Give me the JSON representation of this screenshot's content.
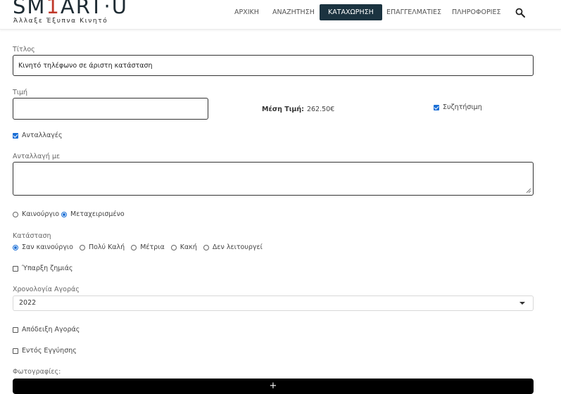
{
  "header": {
    "logo_pre": "SM",
    "logo_accent": "1",
    "logo_post": "ART·U",
    "tagline": "Άλλαξε Έξυπνα Κινητό",
    "nav": [
      {
        "label": "ΑΡΧΙΚΗ",
        "active": false
      },
      {
        "label": "ΑΝΑΖΗΤΗΣΗ",
        "active": false
      },
      {
        "label": "ΚΑΤΑΧΩΡΗΣΗ",
        "active": true
      },
      {
        "label": "ΕΠΑΓΓΕΛΜΑΤΙΕΣ",
        "active": false
      },
      {
        "label": "ΠΛΗΡΟΦΟΡΙΕΣ",
        "active": false
      }
    ],
    "search_icon": "search-icon",
    "active_color": "#1b3340"
  },
  "form": {
    "title_label": "Τίτλος",
    "title_value": "Κινητό τηλέφωνο σε άριστη κατάσταση",
    "price_label": "Τιμή",
    "price_value": "",
    "avg_price_label": "Μέση Τιμή:",
    "avg_price_value": "262.50€",
    "negotiable_label": "Συζητήσιμη",
    "negotiable_checked": true,
    "exchanges_label": "Ανταλλαγές",
    "exchanges_checked": true,
    "exchange_with_label": "Ανταλλαγή με",
    "exchange_with_value": "",
    "newness": {
      "options": [
        "Καινούργιο",
        "Μεταχειρισμένο"
      ],
      "selected": 1
    },
    "condition_label": "Κατάσταση",
    "condition": {
      "options": [
        "Σαν καινούργιο",
        "Πολύ Καλή",
        "Μέτρια",
        "Κακή",
        "Δεν λειτουργεί"
      ],
      "selected": 0
    },
    "damage_label": "Ύπαρξη ζημιάς",
    "damage_checked": false,
    "year_label": "Χρονολογία Αγοράς",
    "year_value": "2022",
    "receipt_label": "Απόδειξη Αγοράς",
    "receipt_checked": false,
    "warranty_label": "Εντός Εγγύησης",
    "warranty_checked": false,
    "photos_label": "Φωτογραφίες:",
    "add_photo_label": "+",
    "accent_color": "#1a6fd6"
  }
}
